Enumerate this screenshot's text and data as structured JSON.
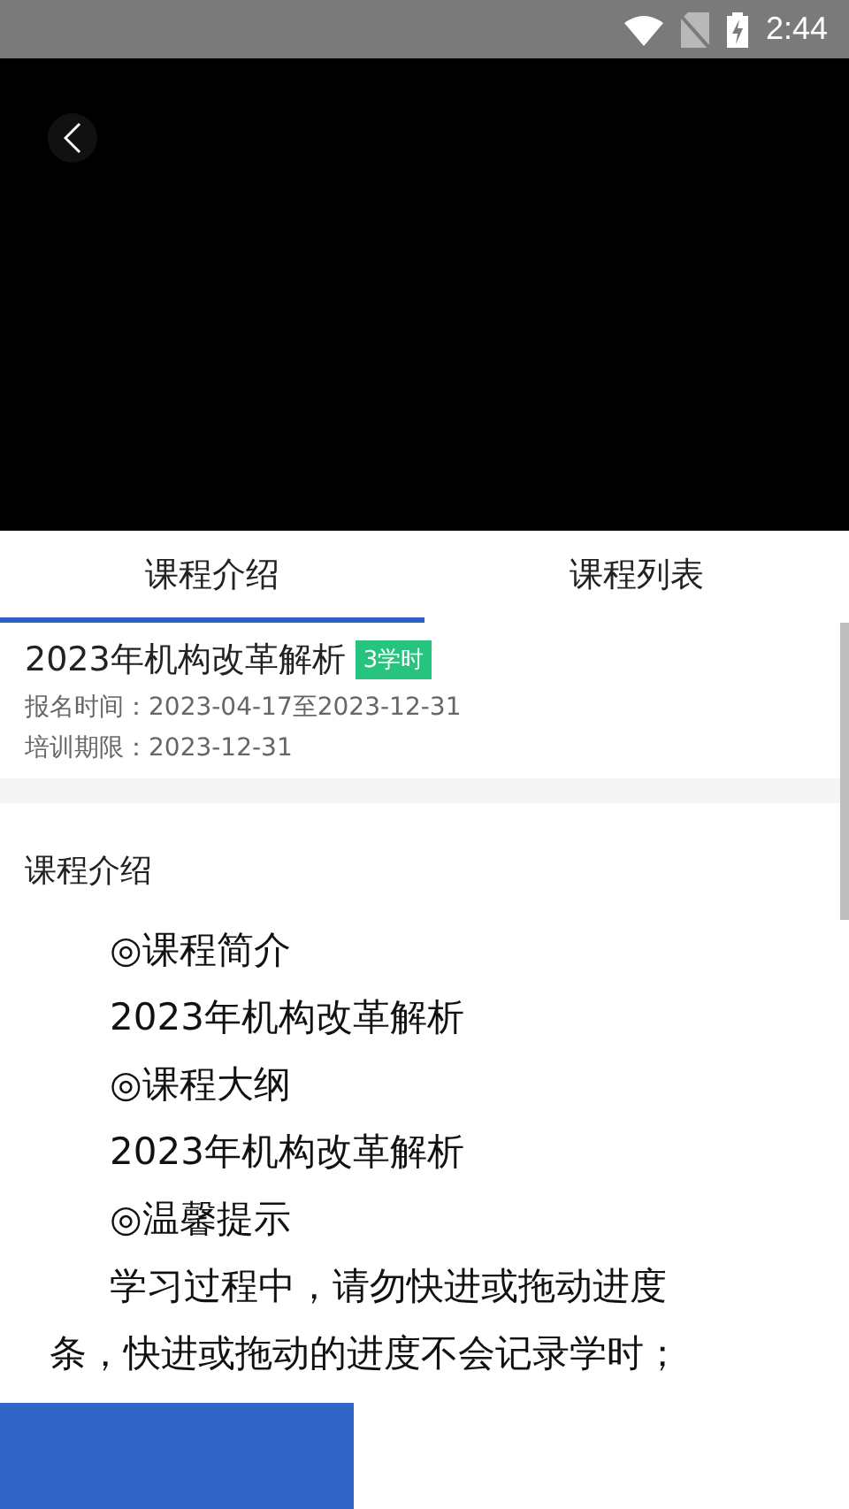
{
  "status_bar": {
    "time": "2:44"
  },
  "tabs": [
    {
      "label": "课程介绍",
      "selected": true
    },
    {
      "label": "课程列表",
      "selected": false
    }
  ],
  "course": {
    "title": "2023年机构改革解析",
    "badge": "3学时",
    "enroll_label": "报名时间：",
    "enroll_value": "2023-04-17至2023-12-31",
    "period_label": "培训期限：",
    "period_value": "2023-12-31"
  },
  "intro": {
    "heading": "课程介绍",
    "lines": [
      {
        "text": "◎课程简介",
        "kind": "indent"
      },
      {
        "text": "2023年机构改革解析",
        "kind": "indent"
      },
      {
        "text": "◎课程大纲",
        "kind": "indent"
      },
      {
        "text": "2023年机构改革解析",
        "kind": "indent"
      },
      {
        "text": "◎温馨提示",
        "kind": "indent"
      },
      {
        "text": "学习过程中，请勿快进或拖动进度",
        "kind": "indent"
      },
      {
        "text": "条，快进或拖动的进度不会记录学时；",
        "kind": "plain"
      }
    ]
  }
}
